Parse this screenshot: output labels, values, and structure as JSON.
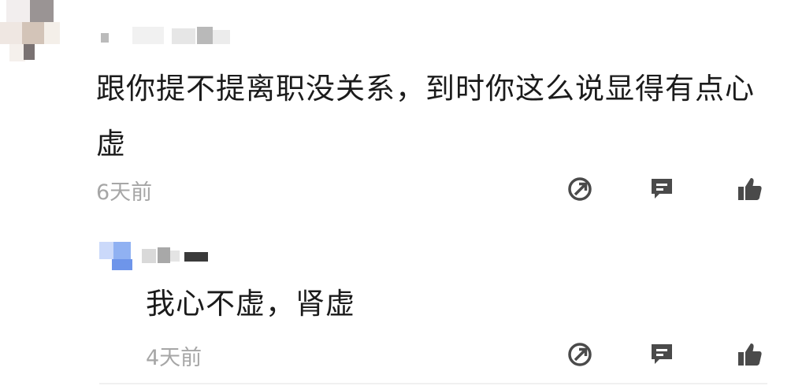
{
  "comment": {
    "text": "跟你提不提离职没关系，到时你这么说显得有点心虚",
    "time": "6天前"
  },
  "reply": {
    "text": "我心不虚，肾虚",
    "time": "4天前"
  },
  "actions": {
    "share_icon": "share-icon",
    "reply_icon": "comment-icon",
    "like_icon": "thumbs-up-icon"
  },
  "colors": {
    "text": "#1b1b1b",
    "meta": "#a6a6a6",
    "icon": "#4a4a4a",
    "reply_avatar": "#7fa6f0"
  }
}
